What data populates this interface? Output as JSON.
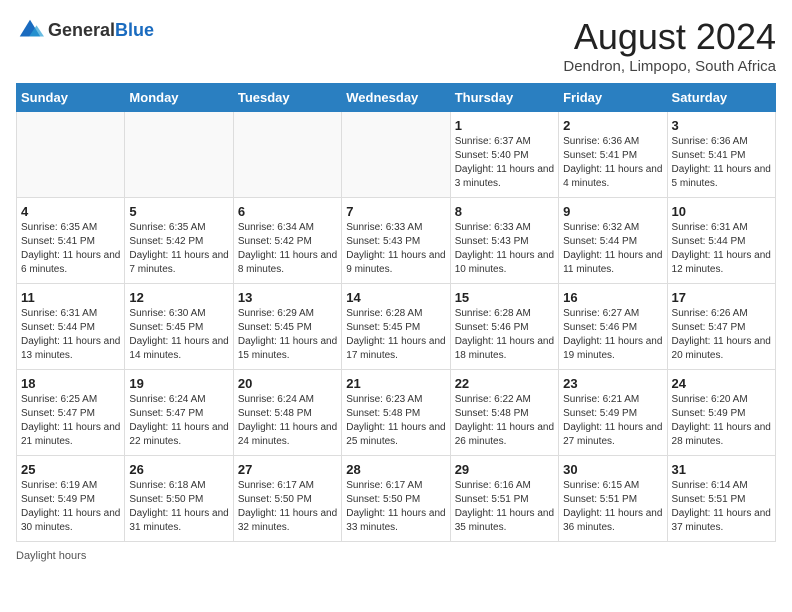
{
  "header": {
    "logo_general": "General",
    "logo_blue": "Blue",
    "month_year": "August 2024",
    "location": "Dendron, Limpopo, South Africa"
  },
  "days_of_week": [
    "Sunday",
    "Monday",
    "Tuesday",
    "Wednesday",
    "Thursday",
    "Friday",
    "Saturday"
  ],
  "footer": {
    "daylight_hours": "Daylight hours"
  },
  "weeks": [
    [
      {
        "day": "",
        "sunrise": "",
        "sunset": "",
        "daylight": "",
        "empty": true
      },
      {
        "day": "",
        "sunrise": "",
        "sunset": "",
        "daylight": "",
        "empty": true
      },
      {
        "day": "",
        "sunrise": "",
        "sunset": "",
        "daylight": "",
        "empty": true
      },
      {
        "day": "",
        "sunrise": "",
        "sunset": "",
        "daylight": "",
        "empty": true
      },
      {
        "day": "1",
        "sunrise": "Sunrise: 6:37 AM",
        "sunset": "Sunset: 5:40 PM",
        "daylight": "Daylight: 11 hours and 3 minutes.",
        "empty": false
      },
      {
        "day": "2",
        "sunrise": "Sunrise: 6:36 AM",
        "sunset": "Sunset: 5:41 PM",
        "daylight": "Daylight: 11 hours and 4 minutes.",
        "empty": false
      },
      {
        "day": "3",
        "sunrise": "Sunrise: 6:36 AM",
        "sunset": "Sunset: 5:41 PM",
        "daylight": "Daylight: 11 hours and 5 minutes.",
        "empty": false
      }
    ],
    [
      {
        "day": "4",
        "sunrise": "Sunrise: 6:35 AM",
        "sunset": "Sunset: 5:41 PM",
        "daylight": "Daylight: 11 hours and 6 minutes.",
        "empty": false
      },
      {
        "day": "5",
        "sunrise": "Sunrise: 6:35 AM",
        "sunset": "Sunset: 5:42 PM",
        "daylight": "Daylight: 11 hours and 7 minutes.",
        "empty": false
      },
      {
        "day": "6",
        "sunrise": "Sunrise: 6:34 AM",
        "sunset": "Sunset: 5:42 PM",
        "daylight": "Daylight: 11 hours and 8 minutes.",
        "empty": false
      },
      {
        "day": "7",
        "sunrise": "Sunrise: 6:33 AM",
        "sunset": "Sunset: 5:43 PM",
        "daylight": "Daylight: 11 hours and 9 minutes.",
        "empty": false
      },
      {
        "day": "8",
        "sunrise": "Sunrise: 6:33 AM",
        "sunset": "Sunset: 5:43 PM",
        "daylight": "Daylight: 11 hours and 10 minutes.",
        "empty": false
      },
      {
        "day": "9",
        "sunrise": "Sunrise: 6:32 AM",
        "sunset": "Sunset: 5:44 PM",
        "daylight": "Daylight: 11 hours and 11 minutes.",
        "empty": false
      },
      {
        "day": "10",
        "sunrise": "Sunrise: 6:31 AM",
        "sunset": "Sunset: 5:44 PM",
        "daylight": "Daylight: 11 hours and 12 minutes.",
        "empty": false
      }
    ],
    [
      {
        "day": "11",
        "sunrise": "Sunrise: 6:31 AM",
        "sunset": "Sunset: 5:44 PM",
        "daylight": "Daylight: 11 hours and 13 minutes.",
        "empty": false
      },
      {
        "day": "12",
        "sunrise": "Sunrise: 6:30 AM",
        "sunset": "Sunset: 5:45 PM",
        "daylight": "Daylight: 11 hours and 14 minutes.",
        "empty": false
      },
      {
        "day": "13",
        "sunrise": "Sunrise: 6:29 AM",
        "sunset": "Sunset: 5:45 PM",
        "daylight": "Daylight: 11 hours and 15 minutes.",
        "empty": false
      },
      {
        "day": "14",
        "sunrise": "Sunrise: 6:28 AM",
        "sunset": "Sunset: 5:45 PM",
        "daylight": "Daylight: 11 hours and 17 minutes.",
        "empty": false
      },
      {
        "day": "15",
        "sunrise": "Sunrise: 6:28 AM",
        "sunset": "Sunset: 5:46 PM",
        "daylight": "Daylight: 11 hours and 18 minutes.",
        "empty": false
      },
      {
        "day": "16",
        "sunrise": "Sunrise: 6:27 AM",
        "sunset": "Sunset: 5:46 PM",
        "daylight": "Daylight: 11 hours and 19 minutes.",
        "empty": false
      },
      {
        "day": "17",
        "sunrise": "Sunrise: 6:26 AM",
        "sunset": "Sunset: 5:47 PM",
        "daylight": "Daylight: 11 hours and 20 minutes.",
        "empty": false
      }
    ],
    [
      {
        "day": "18",
        "sunrise": "Sunrise: 6:25 AM",
        "sunset": "Sunset: 5:47 PM",
        "daylight": "Daylight: 11 hours and 21 minutes.",
        "empty": false
      },
      {
        "day": "19",
        "sunrise": "Sunrise: 6:24 AM",
        "sunset": "Sunset: 5:47 PM",
        "daylight": "Daylight: 11 hours and 22 minutes.",
        "empty": false
      },
      {
        "day": "20",
        "sunrise": "Sunrise: 6:24 AM",
        "sunset": "Sunset: 5:48 PM",
        "daylight": "Daylight: 11 hours and 24 minutes.",
        "empty": false
      },
      {
        "day": "21",
        "sunrise": "Sunrise: 6:23 AM",
        "sunset": "Sunset: 5:48 PM",
        "daylight": "Daylight: 11 hours and 25 minutes.",
        "empty": false
      },
      {
        "day": "22",
        "sunrise": "Sunrise: 6:22 AM",
        "sunset": "Sunset: 5:48 PM",
        "daylight": "Daylight: 11 hours and 26 minutes.",
        "empty": false
      },
      {
        "day": "23",
        "sunrise": "Sunrise: 6:21 AM",
        "sunset": "Sunset: 5:49 PM",
        "daylight": "Daylight: 11 hours and 27 minutes.",
        "empty": false
      },
      {
        "day": "24",
        "sunrise": "Sunrise: 6:20 AM",
        "sunset": "Sunset: 5:49 PM",
        "daylight": "Daylight: 11 hours and 28 minutes.",
        "empty": false
      }
    ],
    [
      {
        "day": "25",
        "sunrise": "Sunrise: 6:19 AM",
        "sunset": "Sunset: 5:49 PM",
        "daylight": "Daylight: 11 hours and 30 minutes.",
        "empty": false
      },
      {
        "day": "26",
        "sunrise": "Sunrise: 6:18 AM",
        "sunset": "Sunset: 5:50 PM",
        "daylight": "Daylight: 11 hours and 31 minutes.",
        "empty": false
      },
      {
        "day": "27",
        "sunrise": "Sunrise: 6:17 AM",
        "sunset": "Sunset: 5:50 PM",
        "daylight": "Daylight: 11 hours and 32 minutes.",
        "empty": false
      },
      {
        "day": "28",
        "sunrise": "Sunrise: 6:17 AM",
        "sunset": "Sunset: 5:50 PM",
        "daylight": "Daylight: 11 hours and 33 minutes.",
        "empty": false
      },
      {
        "day": "29",
        "sunrise": "Sunrise: 6:16 AM",
        "sunset": "Sunset: 5:51 PM",
        "daylight": "Daylight: 11 hours and 35 minutes.",
        "empty": false
      },
      {
        "day": "30",
        "sunrise": "Sunrise: 6:15 AM",
        "sunset": "Sunset: 5:51 PM",
        "daylight": "Daylight: 11 hours and 36 minutes.",
        "empty": false
      },
      {
        "day": "31",
        "sunrise": "Sunrise: 6:14 AM",
        "sunset": "Sunset: 5:51 PM",
        "daylight": "Daylight: 11 hours and 37 minutes.",
        "empty": false
      }
    ]
  ]
}
